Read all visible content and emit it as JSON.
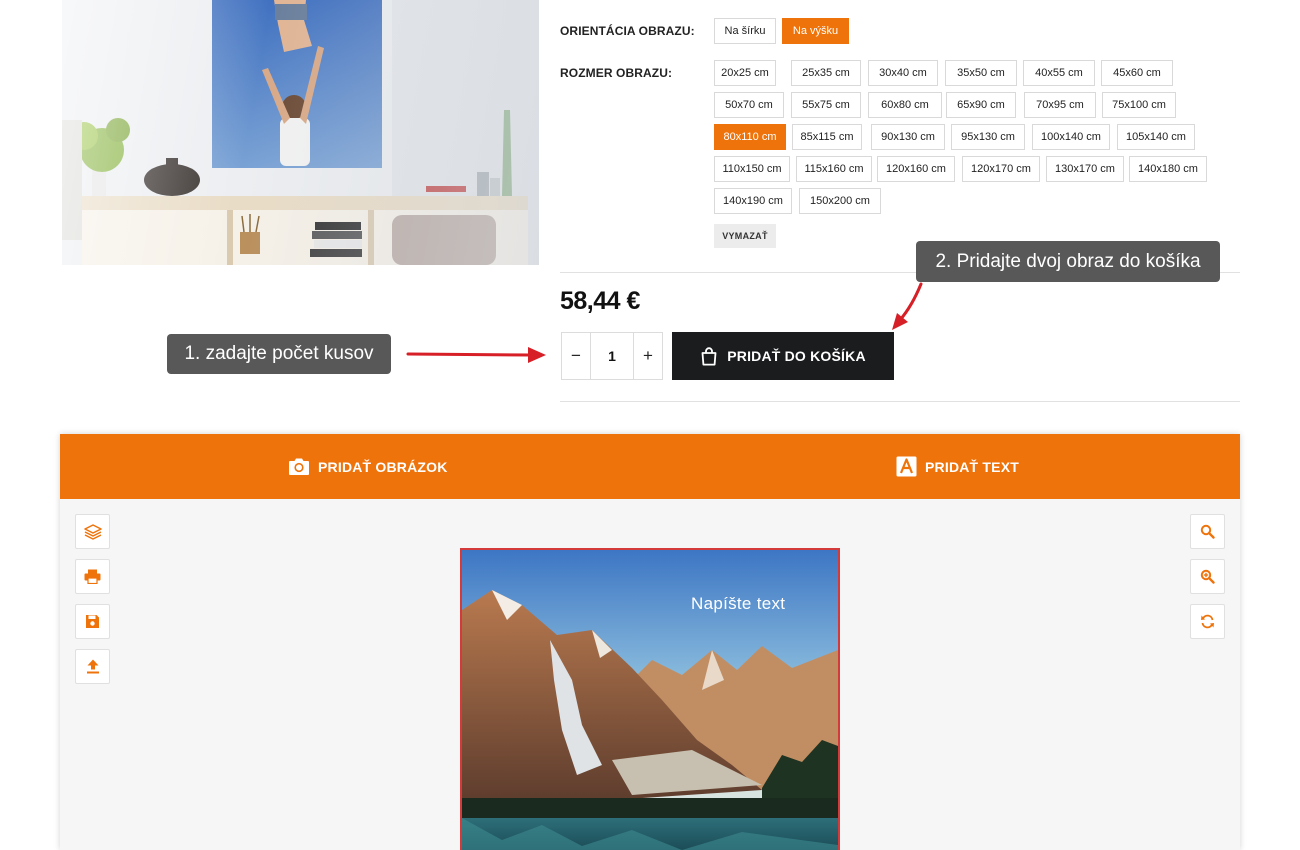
{
  "orientation": {
    "label": "ORIENTÁCIA OBRAZU:",
    "options": [
      "Na šírku",
      "Na výšku"
    ],
    "selected": "Na výšku"
  },
  "size": {
    "label": "ROZMER OBRAZU:",
    "options": [
      "20x25 cm",
      "25x35 cm",
      "30x40 cm",
      "35x50 cm",
      "40x55 cm",
      "45x60 cm",
      "50x70 cm",
      "55x75 cm",
      "60x80 cm",
      "65x90 cm",
      "70x95 cm",
      "75x100 cm",
      "80x110 cm",
      "85x115 cm",
      "90x130 cm",
      "95x130 cm",
      "100x140 cm",
      "105x140 cm",
      "110x150 cm",
      "115x160 cm",
      "120x160 cm",
      "120x170 cm",
      "130x170 cm",
      "140x180 cm",
      "140x190 cm",
      "150x200 cm"
    ],
    "selected": "80x110 cm",
    "clear_label": "VYMAZAŤ"
  },
  "price": "58,44 €",
  "quantity": {
    "minus": "−",
    "value": "1",
    "plus": "+"
  },
  "cart": {
    "label": "PRIDAŤ DO KOŠÍKA",
    "icon": "shopping-bag-icon"
  },
  "callouts": {
    "step1": "1. zadajte počet kusov",
    "step2": "2. Pridajte dvoj obraz do košíka",
    "arrow_color": "#d61f26"
  },
  "designer": {
    "tabs": [
      {
        "label": "PRIDAŤ OBRÁZOK",
        "icon": "camera-icon"
      },
      {
        "label": "PRIDAŤ TEXT",
        "icon": "text-a-icon"
      }
    ],
    "left_tools": [
      "layers-icon",
      "print-icon",
      "save-icon",
      "upload-icon"
    ],
    "right_tools": [
      "zoom-icon",
      "zoom-in-icon",
      "rotate-icon"
    ],
    "canvas_text": "Napíšte text"
  },
  "colors": {
    "accent": "#ef730b",
    "dark": "#1b1c1e",
    "callout": "#585858",
    "canvas_border": "#d43a3a"
  }
}
